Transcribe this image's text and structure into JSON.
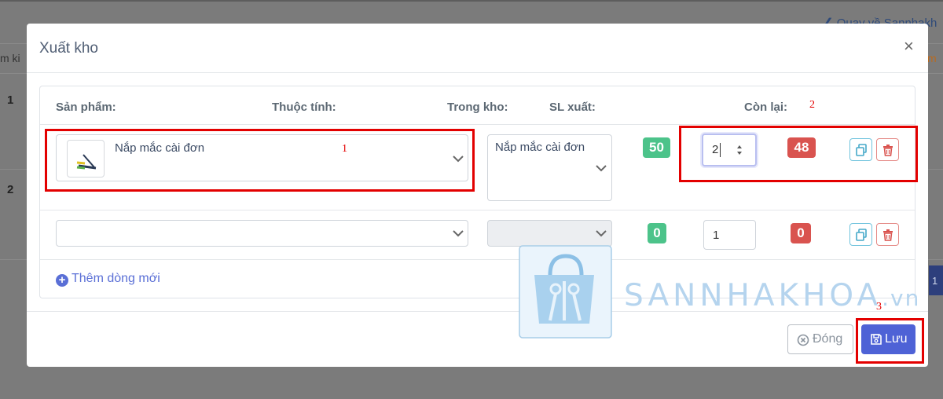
{
  "background": {
    "back_link": "❮ Quay về Sannhakh",
    "left_text": "m ki",
    "right_text": "m",
    "row_numbers": [
      "1",
      "2"
    ],
    "page_button": "1"
  },
  "modal": {
    "title": "Xuất kho",
    "close_symbol": "×",
    "columns": {
      "product": "Sản phẩm:",
      "attribute": "Thuộc tính:",
      "stock": "Trong kho:",
      "export_qty": "SL xuất:",
      "remaining": "Còn lại:"
    },
    "rows": [
      {
        "product": "Nắp mắc cài đơn",
        "attribute": "Nắp mắc cài đơn",
        "stock": "50",
        "export_qty": "2",
        "remaining": "48"
      },
      {
        "product": "",
        "attribute": "",
        "stock": "0",
        "export_qty": "1",
        "remaining": "0"
      }
    ],
    "add_row_label": "Thêm dòng mới",
    "buttons": {
      "close_label": "Đóng",
      "save_label": "Lưu"
    }
  },
  "annotations": {
    "box1": "1",
    "box2": "2",
    "box3": "3"
  },
  "watermark": {
    "text": "SANNHAKHOA",
    "suffix": ".vn"
  },
  "colors": {
    "primary": "#4e62d6",
    "success_badge": "#4cc38a",
    "danger_badge": "#d9534f",
    "annotation_red": "#e30000"
  },
  "icons": [
    "close-icon",
    "chevron-down-icon",
    "copy-icon",
    "trash-icon",
    "plus-circle-icon",
    "times-circle-icon",
    "save-icon",
    "product-thumbnail"
  ]
}
